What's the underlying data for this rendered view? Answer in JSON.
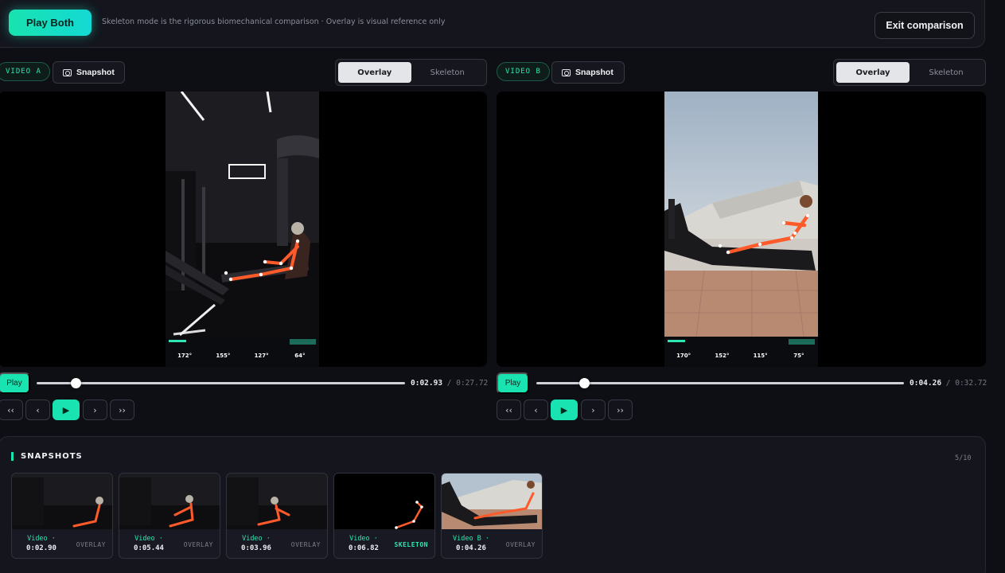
{
  "topbar": {
    "play_both": "Play Both",
    "hint": "Skeleton mode is the rigorous biomechanical comparison · Overlay is visual reference only",
    "exit": "Exit comparison"
  },
  "panels": [
    {
      "label": "VIDEO A",
      "snapshot": "Snapshot",
      "modes": [
        "Overlay",
        "Skeleton"
      ],
      "active_mode": "Overlay",
      "play": "Play",
      "current": "0:02.93",
      "total": "/ 0:27.72",
      "progress": 0.106,
      "hud": {
        "angles": [
          "172°",
          "155°",
          "127°",
          "64°"
        ]
      }
    },
    {
      "label": "VIDEO B",
      "snapshot": "Snapshot",
      "modes": [
        "Overlay",
        "Skeleton"
      ],
      "active_mode": "Overlay",
      "play": "Play",
      "current": "0:04.26",
      "total": "/ 0:32.72",
      "progress": 0.13,
      "hud": {
        "angles": [
          "170°",
          "152°",
          "115°",
          "75°"
        ]
      }
    }
  ],
  "step_buttons": [
    "‹‹",
    "‹",
    "▶",
    "›",
    "››"
  ],
  "snapshots": {
    "title": "SNAPSHOTS",
    "count": "5/10",
    "items": [
      {
        "video": "Video ·",
        "time": "0:02.90",
        "mode": "OVERLAY"
      },
      {
        "video": "Video ·",
        "time": "0:05.44",
        "mode": "OVERLAY"
      },
      {
        "video": "Video ·",
        "time": "0:03.96",
        "mode": "OVERLAY"
      },
      {
        "video": "Video ·",
        "time": "0:06.82",
        "mode": "SKELETON"
      },
      {
        "video": "Video B ·",
        "time": "0:04.26",
        "mode": "OVERLAY"
      }
    ]
  },
  "colors": {
    "accent": "#19e3b0",
    "skeleton": "#ff5a2a"
  }
}
